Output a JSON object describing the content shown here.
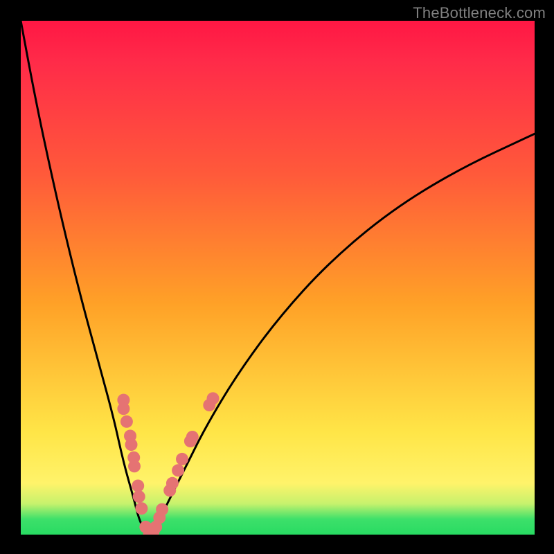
{
  "watermark": "TheBottleneck.com",
  "chart_data": {
    "type": "line",
    "title": "",
    "xlabel": "",
    "ylabel": "",
    "xlim": [
      0,
      100
    ],
    "ylim": [
      0,
      100
    ],
    "series": [
      {
        "name": "bottleneck-curve",
        "x": [
          0,
          3,
          6,
          9,
          12,
          15,
          18,
          20,
          22,
          23,
          24,
          25,
          26,
          27,
          29,
          32,
          36,
          42,
          50,
          60,
          72,
          85,
          100
        ],
        "y": [
          100,
          84,
          70,
          57,
          45,
          34,
          23,
          14,
          7,
          3,
          1,
          0,
          1,
          3,
          7,
          13,
          21,
          31,
          42,
          53,
          63,
          71,
          78
        ]
      }
    ],
    "highlight_points": {
      "name": "scatter-markers",
      "color": "#e57373",
      "points": [
        {
          "x": 20.0,
          "y": 26.2
        },
        {
          "x": 20.0,
          "y": 24.5
        },
        {
          "x": 20.6,
          "y": 22.0
        },
        {
          "x": 21.3,
          "y": 19.2
        },
        {
          "x": 21.5,
          "y": 17.5
        },
        {
          "x": 22.0,
          "y": 15.0
        },
        {
          "x": 22.1,
          "y": 13.3
        },
        {
          "x": 22.8,
          "y": 9.5
        },
        {
          "x": 23.0,
          "y": 7.4
        },
        {
          "x": 23.5,
          "y": 5.1
        },
        {
          "x": 24.3,
          "y": 1.5
        },
        {
          "x": 25.0,
          "y": 0.0
        },
        {
          "x": 25.8,
          "y": 0.6
        },
        {
          "x": 26.3,
          "y": 1.5
        },
        {
          "x": 27.0,
          "y": 3.3
        },
        {
          "x": 27.5,
          "y": 4.9
        },
        {
          "x": 29.0,
          "y": 8.6
        },
        {
          "x": 29.5,
          "y": 10.0
        },
        {
          "x": 30.6,
          "y": 12.5
        },
        {
          "x": 31.4,
          "y": 14.7
        },
        {
          "x": 33.0,
          "y": 18.2
        },
        {
          "x": 33.4,
          "y": 19.0
        },
        {
          "x": 36.7,
          "y": 25.2
        },
        {
          "x": 37.4,
          "y": 26.5
        }
      ]
    },
    "gradient_stops": [
      {
        "pos": 0.0,
        "color": "#ff1744"
      },
      {
        "pos": 0.3,
        "color": "#ff5a3a"
      },
      {
        "pos": 0.55,
        "color": "#ffa127"
      },
      {
        "pos": 0.8,
        "color": "#ffe547"
      },
      {
        "pos": 0.94,
        "color": "#c6f26d"
      },
      {
        "pos": 1.0,
        "color": "#28db62"
      }
    ]
  }
}
